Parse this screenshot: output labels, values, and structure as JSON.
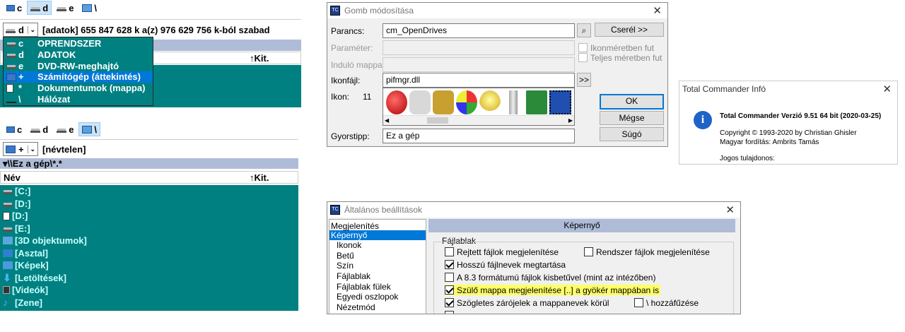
{
  "panel1": {
    "drives": [
      {
        "icon": "pc",
        "letter": "c"
      },
      {
        "icon": "hd",
        "letter": "d",
        "selected": true
      },
      {
        "icon": "cd",
        "letter": "e"
      },
      {
        "icon": "net",
        "letter": "\\"
      }
    ],
    "combo_value": "d",
    "combo_info": "[adatok]  655 847 628 k a(z) 976 629 756 k-ból szabad",
    "col_kit": "Kit.",
    "dropdown": [
      {
        "key": "c",
        "label": "OPRENDSZER"
      },
      {
        "key": "d",
        "label": "ADATOK"
      },
      {
        "key": "e",
        "label": "DVD-RW-meghajtó"
      },
      {
        "key": "+",
        "label": "Számítógép (áttekintés)",
        "selected": true
      },
      {
        "key": "*",
        "label": "Dokumentumok (mappa)"
      },
      {
        "key": "\\",
        "label": "Hálózat"
      }
    ]
  },
  "panel2": {
    "drives": [
      {
        "letter": "c"
      },
      {
        "letter": "d"
      },
      {
        "letter": "e"
      },
      {
        "letter": "\\",
        "selected": true
      }
    ],
    "combo_value": "+",
    "combo_info": "[névtelen]",
    "path": "\\\\Ez a gép\\*.*",
    "col_name": "Név",
    "col_kit": "Kit.",
    "files": [
      "[C:]",
      "[D:]",
      "[D:]",
      "[E:]",
      "[3D objektumok]",
      "[Asztal]",
      "[Képek]",
      "[Letöltések]",
      "[Videók]",
      "[Zene]"
    ]
  },
  "dialog1": {
    "title": "Gomb módosítása",
    "parancs_label": "Parancs:",
    "parancs_value": "cm_OpenDrives",
    "csere_btn": "Cserél >>",
    "parameter_label": "Paraméter:",
    "indulo_label": "Induló mappa",
    "ikon_meret": "Ikonméretben fut",
    "teljes_meret": "Teljes méretben fut",
    "ikonfajl_label": "Ikonfájl:",
    "ikonfajl_value": "pifmgr.dll",
    "browse_btn": ">>",
    "ikon_label": "Ikon:",
    "ikon_num": "11",
    "ok_btn": "OK",
    "megse_btn": "Mégse",
    "sugo_btn": "Súgó",
    "gyorstipp_label": "Gyorstipp:",
    "gyorstipp_value": "Ez a gép"
  },
  "info": {
    "title": "Total Commander Infó",
    "line1": "Total Commander Verzió 9.51 64 bit (2020-03-25)",
    "line2": "Copyright © 1993-2020 by Christian Ghisler",
    "line3": "Magyar fordítás: Ambrits Tamás",
    "line4": "Jogos tulajdonos:"
  },
  "settings": {
    "title": "Általános beállítások",
    "tree": [
      "Megjelenítés",
      "Képernyő",
      "Ikonok",
      "Betű",
      "Szín",
      "Fájlablak",
      "Fájlablak fülek",
      "Egyedi oszlopok",
      "Nézetmód"
    ],
    "header": "Képernyő",
    "group": "Fájlablak",
    "rejtett": "Rejtett fájlok megjelenítése",
    "rendszer": "Rendszer fájlok megjelenítése",
    "hosszu": "Hosszú fájlnevek megtartása",
    "formatum": "A 8.3 formátumú fájlok kisbetűvel (mint az intézőben)",
    "szulo": "Szülő mappa megjelenítése [..] a gyökér mappában is",
    "szogletes": "Szögletes zárójelek a mappanevek körül",
    "hozzafuzese": "\\ hozzáfűzése",
    "highlight": "#ffff66"
  }
}
